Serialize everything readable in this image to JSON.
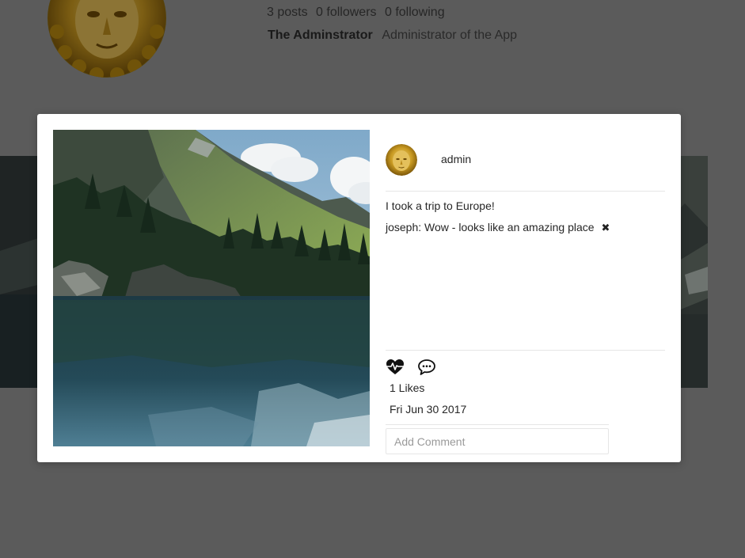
{
  "profile": {
    "stats": {
      "posts": "3 posts",
      "followers": "0 followers",
      "following": "0 following"
    },
    "full_name": "The Adminstrator",
    "bio": "Administrator of the App"
  },
  "modal": {
    "post": {
      "username": "admin",
      "caption": "I took a trip to Europe!",
      "comments": [
        {
          "text": "joseph: Wow - looks like an amazing place",
          "delete_icon": "close-icon"
        }
      ],
      "likes": "1 Likes",
      "date": "Fri Jun 30 2017",
      "comment_placeholder": "Add Comment"
    },
    "icons": {
      "like": "heart-pulse-icon",
      "comment": "speech-bubble-icon"
    }
  }
}
